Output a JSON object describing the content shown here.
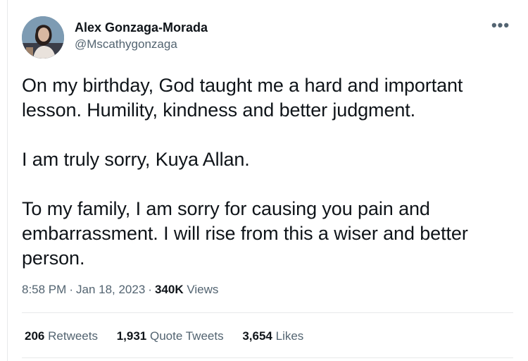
{
  "user": {
    "display_name": "Alex Gonzaga-Morada",
    "handle": "@Mscathygonzaga",
    "avatar_icon": "profile-photo"
  },
  "menu": {
    "more_label": "•••"
  },
  "tweet": {
    "paragraphs": [
      "On my birthday, God taught me a hard and important lesson. Humility, kindness and better judgment.",
      "I am truly sorry, Kuya Allan.",
      "To my family, I am sorry for causing you pain and embarrassment. I will rise from this a wiser and better person."
    ]
  },
  "meta": {
    "time": "8:58 PM",
    "separator": "·",
    "date": "Jan 18, 2023",
    "views_count": "340K",
    "views_label": "Views"
  },
  "stats": {
    "retweets_count": "206",
    "retweets_label": "Retweets",
    "quotes_count": "1,931",
    "quotes_label": "Quote Tweets",
    "likes_count": "3,654",
    "likes_label": "Likes"
  }
}
